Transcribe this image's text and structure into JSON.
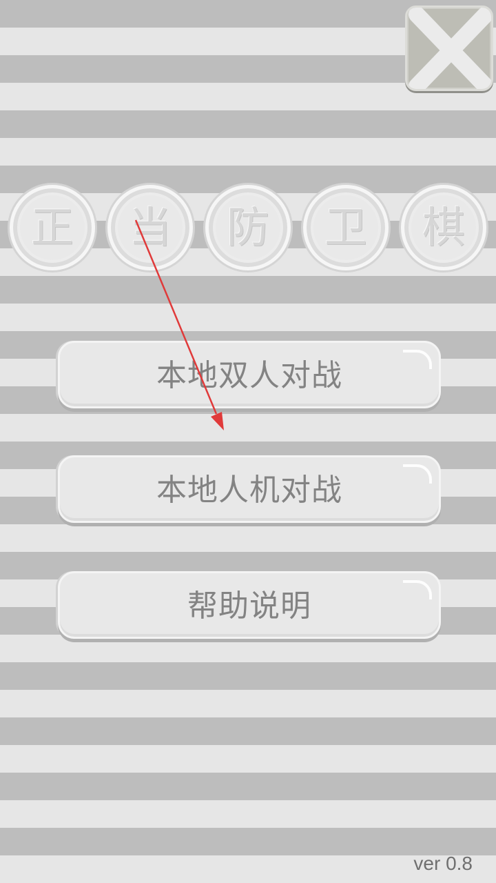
{
  "title_chars": [
    "正",
    "当",
    "防",
    "卫",
    "棋"
  ],
  "menu": {
    "local_pvp": "本地双人对战",
    "local_pve": "本地人机对战",
    "help": "帮助说明"
  },
  "version": "ver 0.8",
  "icons": {
    "close": "close-x-icon"
  },
  "colors": {
    "stripe_dark": "#bdbdbd",
    "stripe_light": "#e6e6e6",
    "button_face": "#e8e8e8",
    "button_text": "#838383",
    "annotation_arrow": "#e03a3a"
  }
}
